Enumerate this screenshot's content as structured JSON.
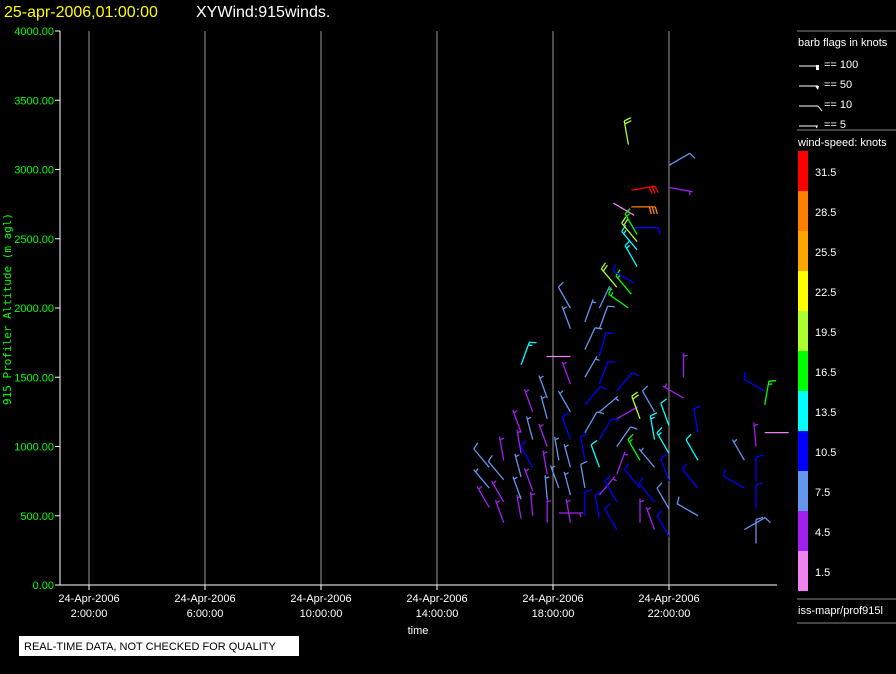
{
  "header": {
    "datetime": "25-apr-2006,01:00:00",
    "title": "XYWind:915winds."
  },
  "footer": {
    "quality_notice": "REAL-TIME DATA, NOT CHECKED FOR QUALITY"
  },
  "legend": {
    "barb_title": "barb flags in knots",
    "barb_items": [
      {
        "label": "== 100",
        "kind": "flag100"
      },
      {
        "label": "== 50",
        "kind": "flag50"
      },
      {
        "label": "== 10",
        "kind": "full"
      },
      {
        "label": "== 5",
        "kind": "half"
      }
    ],
    "speed_title": "wind-speed: knots",
    "speed_bins": [
      {
        "label": "31.5",
        "color": "#ff0000"
      },
      {
        "label": "28.5",
        "color": "#ff8000"
      },
      {
        "label": "25.5",
        "color": "#ffa500"
      },
      {
        "label": "22.5",
        "color": "#ffff00"
      },
      {
        "label": "19.5",
        "color": "#adff2f"
      },
      {
        "label": "16.5",
        "color": "#00ff00"
      },
      {
        "label": "13.5",
        "color": "#00ffff"
      },
      {
        "label": "10.5",
        "color": "#0000ff"
      },
      {
        "label": "7.5",
        "color": "#6495ed"
      },
      {
        "label": "4.5",
        "color": "#a020f0"
      },
      {
        "label": "1.5",
        "color": "#ee82ee"
      }
    ],
    "source": "iss-mapr/prof915l"
  },
  "chart_data": {
    "type": "scatter",
    "title": "XYWind:915winds.",
    "xlabel": "time",
    "ylabel": "915 Profiler Altitude (m agl)",
    "xlim_hours": [
      1,
      25.7
    ],
    "ylim": [
      0,
      4000
    ],
    "y_ticks": [
      "0.00",
      "500.00",
      "1000.00",
      "1500.00",
      "2000.00",
      "2500.00",
      "3000.00",
      "3500.00",
      "4000.00"
    ],
    "x_ticks": [
      {
        "hour": 2,
        "date": "24-Apr-2006",
        "time": "2:00:00"
      },
      {
        "hour": 6,
        "date": "24-Apr-2006",
        "time": "6:00:00"
      },
      {
        "hour": 10,
        "date": "24-Apr-2006",
        "time": "10:00:00"
      },
      {
        "hour": 14,
        "date": "24-Apr-2006",
        "time": "14:00:00"
      },
      {
        "hour": 18,
        "date": "24-Apr-2006",
        "time": "18:00:00"
      },
      {
        "hour": 22,
        "date": "24-Apr-2006",
        "time": "22:00:00"
      }
    ],
    "grid": "vertical",
    "point_fields": [
      "hour",
      "altitude_m",
      "speed_kt",
      "direction_deg"
    ],
    "points": [
      [
        15.8,
        560,
        5,
        330
      ],
      [
        15.8,
        700,
        7,
        320
      ],
      [
        15.8,
        850,
        8,
        320
      ],
      [
        16.3,
        450,
        3,
        340
      ],
      [
        16.3,
        600,
        5,
        330
      ],
      [
        16.3,
        760,
        8,
        320
      ],
      [
        16.3,
        900,
        5,
        350
      ],
      [
        16.9,
        480,
        4,
        350
      ],
      [
        16.9,
        620,
        7,
        340
      ],
      [
        16.9,
        780,
        6,
        345
      ],
      [
        16.9,
        950,
        4,
        350
      ],
      [
        16.9,
        1100,
        5,
        340
      ],
      [
        16.9,
        1590,
        14,
        20
      ],
      [
        17.3,
        500,
        5,
        355
      ],
      [
        17.3,
        680,
        4,
        340
      ],
      [
        17.3,
        850,
        9,
        330
      ],
      [
        17.3,
        1050,
        6,
        345
      ],
      [
        17.3,
        1250,
        5,
        340
      ],
      [
        17.8,
        450,
        5,
        0
      ],
      [
        17.8,
        620,
        6,
        355
      ],
      [
        17.8,
        800,
        4,
        350
      ],
      [
        17.8,
        1000,
        5,
        340
      ],
      [
        17.8,
        1200,
        7,
        345
      ],
      [
        17.8,
        1350,
        6,
        340
      ],
      [
        18.2,
        520,
        5,
        90
      ],
      [
        18.2,
        700,
        7,
        340
      ],
      [
        18.2,
        900,
        6,
        350
      ],
      [
        18.6,
        450,
        5,
        350
      ],
      [
        18.6,
        650,
        6,
        345
      ],
      [
        18.6,
        850,
        7,
        345
      ],
      [
        18.6,
        1050,
        9,
        340
      ],
      [
        18.6,
        1250,
        6,
        330
      ],
      [
        18.6,
        1450,
        5,
        340
      ],
      [
        18.6,
        1650,
        2,
        270
      ],
      [
        18.6,
        1850,
        6,
        340
      ],
      [
        18.6,
        2000,
        8,
        330
      ],
      [
        19.1,
        500,
        10,
        0
      ],
      [
        19.1,
        700,
        8,
        350
      ],
      [
        19.1,
        900,
        11,
        350
      ],
      [
        19.1,
        1100,
        8,
        30
      ],
      [
        19.1,
        1300,
        9,
        40
      ],
      [
        19.1,
        1500,
        7,
        30
      ],
      [
        19.1,
        1700,
        8,
        25
      ],
      [
        19.1,
        1900,
        7,
        20
      ],
      [
        19.6,
        480,
        10,
        350
      ],
      [
        19.6,
        650,
        5,
        40
      ],
      [
        19.6,
        850,
        12,
        340
      ],
      [
        19.6,
        1050,
        9,
        30
      ],
      [
        19.6,
        1250,
        6,
        50
      ],
      [
        19.6,
        1450,
        10,
        20
      ],
      [
        19.6,
        1650,
        9,
        15
      ],
      [
        19.6,
        1850,
        8,
        20
      ],
      [
        19.6,
        2000,
        7,
        25
      ],
      [
        20.2,
        400,
        11,
        330
      ],
      [
        20.2,
        600,
        9,
        330
      ],
      [
        20.2,
        800,
        5,
        20
      ],
      [
        20.2,
        1000,
        8,
        35
      ],
      [
        20.2,
        1200,
        5,
        60
      ],
      [
        20.2,
        1400,
        9,
        40
      ],
      [
        20.2,
        2150,
        20,
        320
      ],
      [
        20.6,
        2000,
        17,
        305
      ],
      [
        20.7,
        2100,
        16,
        320
      ],
      [
        20.6,
        3180,
        20,
        350
      ],
      [
        21.0,
        450,
        4,
        0
      ],
      [
        21.0,
        700,
        10,
        320
      ],
      [
        21.0,
        900,
        15,
        330
      ],
      [
        21.0,
        1200,
        19,
        340
      ],
      [
        20.8,
        2180,
        11,
        300
      ],
      [
        20.9,
        2300,
        14,
        330
      ],
      [
        20.9,
        2420,
        13,
        320
      ],
      [
        20.9,
        2480,
        19,
        320
      ],
      [
        20.9,
        2530,
        17,
        330
      ],
      [
        20.8,
        2580,
        10,
        90
      ],
      [
        20.8,
        2670,
        2,
        300
      ],
      [
        20.7,
        2730,
        28,
        90
      ],
      [
        20.7,
        2850,
        32,
        80
      ],
      [
        21.5,
        400,
        5,
        340
      ],
      [
        21.5,
        600,
        11,
        320
      ],
      [
        21.5,
        850,
        7,
        320
      ],
      [
        21.5,
        1050,
        13,
        350
      ],
      [
        21.5,
        1250,
        8,
        330
      ],
      [
        22.0,
        2870,
        5,
        100
      ],
      [
        22.0,
        3030,
        8,
        60
      ],
      [
        22.0,
        350,
        9,
        330
      ],
      [
        22.0,
        550,
        8,
        330
      ],
      [
        22.0,
        750,
        10,
        340
      ],
      [
        22.0,
        950,
        13,
        330
      ],
      [
        22.0,
        1150,
        12,
        340
      ],
      [
        22.5,
        1500,
        5,
        0
      ],
      [
        22.5,
        1350,
        5,
        300
      ],
      [
        23.0,
        500,
        8,
        300
      ],
      [
        23.0,
        700,
        9,
        320
      ],
      [
        23.0,
        900,
        12,
        330
      ],
      [
        23.0,
        1100,
        10,
        350
      ],
      [
        24.6,
        400,
        8,
        60
      ],
      [
        24.6,
        700,
        10,
        300
      ],
      [
        24.6,
        900,
        6,
        330
      ],
      [
        25.0,
        300,
        8,
        0
      ],
      [
        25.0,
        550,
        9,
        0
      ],
      [
        25.0,
        750,
        11,
        0
      ],
      [
        25.0,
        1000,
        5,
        355
      ],
      [
        25.3,
        1100,
        2,
        90
      ],
      [
        25.3,
        1300,
        17,
        10
      ],
      [
        25.3,
        1400,
        10,
        300
      ]
    ]
  }
}
